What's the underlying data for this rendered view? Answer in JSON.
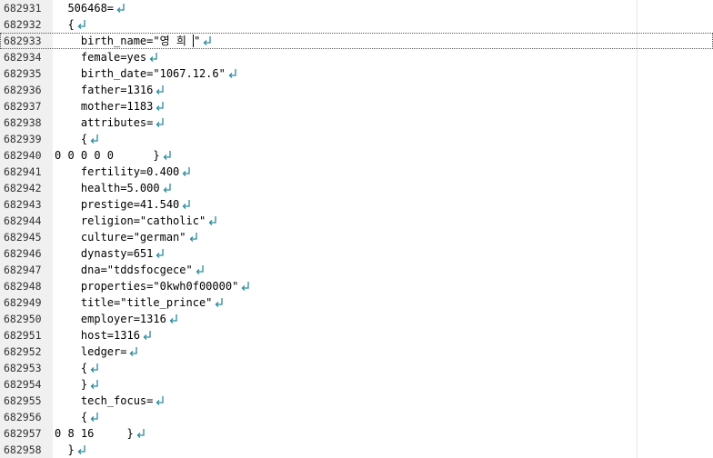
{
  "editor": {
    "eol_symbol": "crlf-arrow-icon",
    "eol_color": "#2a8a9a",
    "lines": [
      {
        "num": "682931",
        "text": "  506468="
      },
      {
        "num": "682932",
        "text": "  {"
      },
      {
        "num": "682933",
        "text": "    birth_name=\"영 희 \"",
        "current": true
      },
      {
        "num": "682934",
        "text": "    female=yes"
      },
      {
        "num": "682935",
        "text": "    birth_date=\"1067.12.6\""
      },
      {
        "num": "682936",
        "text": "    father=1316"
      },
      {
        "num": "682937",
        "text": "    mother=1183"
      },
      {
        "num": "682938",
        "text": "    attributes="
      },
      {
        "num": "682939",
        "text": "    {"
      },
      {
        "num": "682940",
        "text": "0 0 0 0 0      }"
      },
      {
        "num": "682941",
        "text": "    fertility=0.400"
      },
      {
        "num": "682942",
        "text": "    health=5.000"
      },
      {
        "num": "682943",
        "text": "    prestige=41.540"
      },
      {
        "num": "682944",
        "text": "    religion=\"catholic\""
      },
      {
        "num": "682945",
        "text": "    culture=\"german\""
      },
      {
        "num": "682946",
        "text": "    dynasty=651"
      },
      {
        "num": "682947",
        "text": "    dna=\"tddsfocgece\""
      },
      {
        "num": "682948",
        "text": "    properties=\"0kwh0f00000\""
      },
      {
        "num": "682949",
        "text": "    title=\"title_prince\""
      },
      {
        "num": "682950",
        "text": "    employer=1316"
      },
      {
        "num": "682951",
        "text": "    host=1316"
      },
      {
        "num": "682952",
        "text": "    ledger="
      },
      {
        "num": "682953",
        "text": "    {"
      },
      {
        "num": "682954",
        "text": "    }"
      },
      {
        "num": "682955",
        "text": "    tech_focus="
      },
      {
        "num": "682956",
        "text": "    {"
      },
      {
        "num": "682957",
        "text": "0 8 16     }"
      },
      {
        "num": "682958",
        "text": "  }"
      }
    ]
  }
}
